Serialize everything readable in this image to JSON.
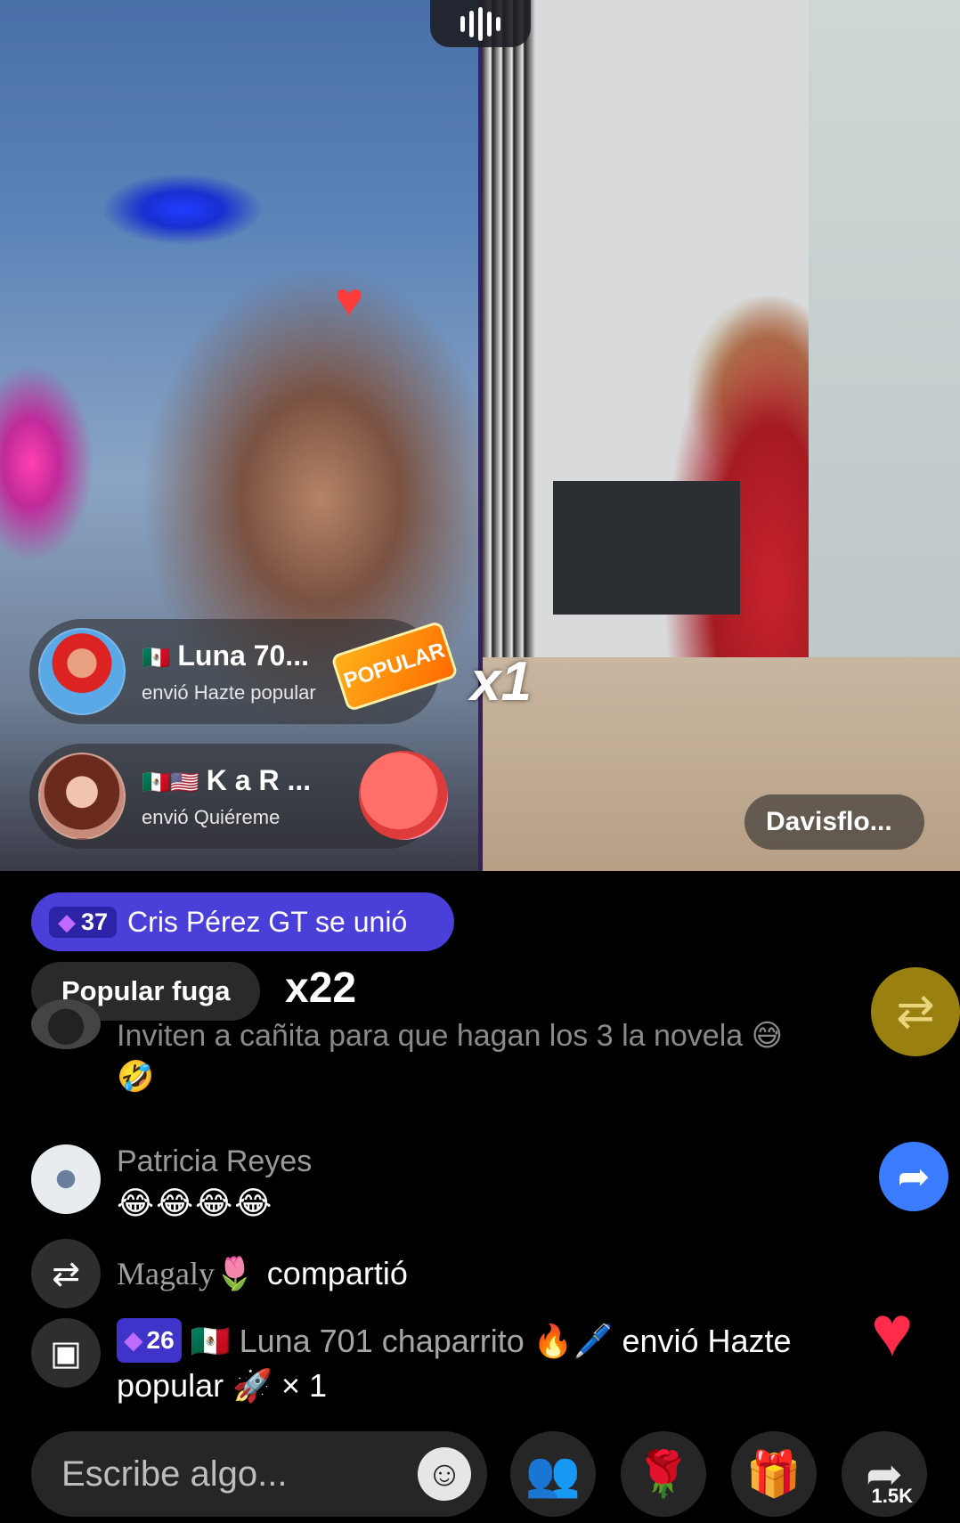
{
  "stream": {
    "gifts": [
      {
        "flags": "🇲🇽",
        "name": "Luna 70...",
        "desc": "envió Hazte popular",
        "sticker": "POPULAR"
      },
      {
        "flags": "🇲🇽🇺🇸",
        "name": "K a R ...",
        "desc": "envió Quiéreme"
      }
    ],
    "gift_multiplier": "x1",
    "host_label": "Davisflo..."
  },
  "chat": {
    "join": {
      "level": "37",
      "text": "Cris Pérez GT se unió"
    },
    "popular": {
      "label": "Popular fuga",
      "count": "x22"
    },
    "messages": [
      {
        "text": "Inviten a cañita para que hagan los 3 la novela 😅",
        "text2": "🤣"
      },
      {
        "name": "Patricia Reyes",
        "text": "😂😂😂😂"
      }
    ],
    "shared": {
      "user": "Magaly🌷",
      "verb": "compartió"
    },
    "gift_event": {
      "level": "26",
      "flag": "🇲🇽",
      "user": "Luna 701 chaparrito 🔥🖊️",
      "action": "envió Hazte",
      "line2": "popular",
      "line2_icon": "🚀",
      "multiplier": "× 1"
    }
  },
  "bottom_bar": {
    "input_placeholder": "Escribe algo...",
    "share_count": "1.5K"
  },
  "icons": {
    "audio": "audio-wave-icon",
    "gem": "diamond-icon",
    "repost": "repost-icon",
    "forward": "forward-arrow-icon",
    "gift": "gift-box-icon",
    "emoji": "emoji-icon",
    "guests": "guests-icon",
    "rose": "rose-icon",
    "heart": "heart-icon"
  },
  "colors": {
    "join_banner": "#4b3fd9",
    "forward_button": "#3b7cff",
    "heart": "#ff2b4a",
    "gift_button": "#ff3c8c"
  }
}
